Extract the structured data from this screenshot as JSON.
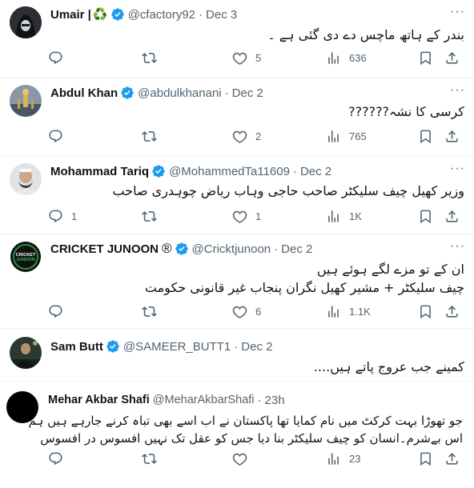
{
  "tweets": [
    {
      "name": "Umair |",
      "name_extra": "♻️",
      "handle": "@cfactory92",
      "date": "Dec 3",
      "lines": [
        "بندر کے ہاتھ ماچس دے دی گئی ہے ۔"
      ],
      "replies": "",
      "retweets": "",
      "likes": "5",
      "views": "636",
      "avatar": "hooded-figure-avatar"
    },
    {
      "name": "Abdul Khan",
      "name_extra": "",
      "handle": "@abdulkhanani",
      "date": "Dec 2",
      "lines": [
        "کرسی کا نشہ??????"
      ],
      "replies": "",
      "retweets": "",
      "likes": "2",
      "views": "765",
      "avatar": "mosque-avatar"
    },
    {
      "name": "Mohammad Tariq",
      "name_extra": "",
      "handle": "@MohammedTa11609",
      "date": "Dec 2",
      "lines": [
        "وزیر کھیل چیف سلیکٹر صاحب حاجی وہاب ریاض چوہدری صاحب"
      ],
      "replies": "1",
      "retweets": "",
      "likes": "1",
      "views": "1K",
      "avatar": "man-avatar"
    },
    {
      "name": "CRICKET JUNOON",
      "name_extra": "®",
      "handle": "@Cricktjunoon",
      "date": "Dec 2",
      "lines": [
        "ان کے تو مزے لگے ہوئے ہیں",
        "چیف سلیکٹر  + مشیر کھیل نگران پنجاب غیر قانونی حکومت"
      ],
      "replies": "",
      "retweets": "",
      "likes": "6",
      "views": "1.1K",
      "avatar": "cricket-junoon-logo",
      "logo_text": "CRICKET JUNOON"
    },
    {
      "name": "Sam Butt",
      "name_extra": "",
      "handle": "@SAMEER_BUTT1",
      "date": "Dec 2",
      "lines": [
        "کمینے جب عروج پاتے ہیں...."
      ],
      "replies": "",
      "retweets": "",
      "likes": "",
      "views": "",
      "avatar": "man-stage-avatar"
    },
    {
      "name": "Mehar Akbar Shafi",
      "name_extra": "",
      "handle": "@MeharAkbarShafi",
      "date": "23h",
      "lines": [
        "جو تھوڑا بہت کرکٹ میں نام کمایا تھا پاکستان نے اب اسے بھی تباہ کرنے جارہے ہیں ہم",
        "اس بےشرم۔انسان کو چیف سلیکٹر بنا دیا جس کو عقل تک نہیں افسوس در افسوس"
      ],
      "replies": "",
      "retweets": "",
      "likes": "",
      "views": "23",
      "avatar": "black-avatar"
    }
  ],
  "colors": {
    "text": "#0f1419",
    "secondary": "#536471",
    "verified": "#1d9bf0",
    "divider": "#eff3f4"
  }
}
